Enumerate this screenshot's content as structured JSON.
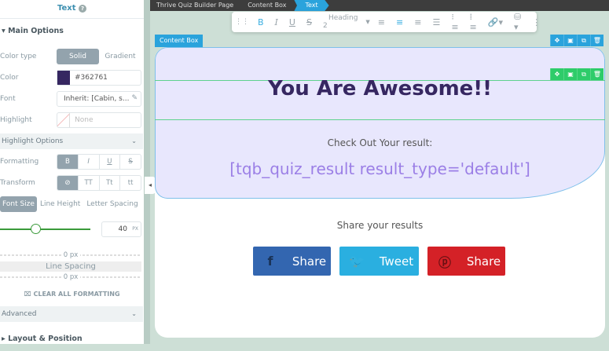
{
  "panel": {
    "title": "Text",
    "help": "?",
    "main_options": "Main Options",
    "color_type_label": "Color type",
    "solid": "Solid",
    "gradient": "Gradient",
    "color_label": "Color",
    "color_value": "#362761",
    "font_label": "Font",
    "font_value": "Inherit: [Cabin, s...",
    "highlight_label": "Highlight",
    "highlight_value": "None",
    "highlight_options": "Highlight Options",
    "formatting_label": "Formatting",
    "fmt": [
      "B",
      "I",
      "U",
      "S"
    ],
    "transform_label": "Transform",
    "tr": [
      "⊘",
      "TT",
      "Tt",
      "tt"
    ],
    "tabs": [
      "Font Size",
      "Line Height",
      "Letter Spacing"
    ],
    "font_size": "40",
    "unit": "PX",
    "slider_fraction": 0.4,
    "spacing_top": "0 px",
    "line_spacing": "Line Spacing",
    "spacing_bottom": "0 px",
    "clear": "CLEAR ALL FORMATTING",
    "advanced": "Advanced",
    "layout": "Layout & Position"
  },
  "breadcrumb": [
    "Thrive Quiz Builder Page",
    "Content Box",
    "Text"
  ],
  "toolbar": {
    "heading": "Heading 2"
  },
  "canvas": {
    "tag": "Content Box",
    "heading": "You Are Awesome!!",
    "check": "Check Out Your result:",
    "shortcode": "[tqb_quiz_result result_type='default']",
    "share_title": "Share your results",
    "buttons": [
      {
        "label": "Share",
        "color": "#3366b0"
      },
      {
        "label": "Tweet",
        "color": "#2aafe0"
      },
      {
        "label": "Share",
        "color": "#d42127"
      }
    ]
  },
  "colors": {
    "accent": "#2aa3dc",
    "text": "#362761"
  }
}
